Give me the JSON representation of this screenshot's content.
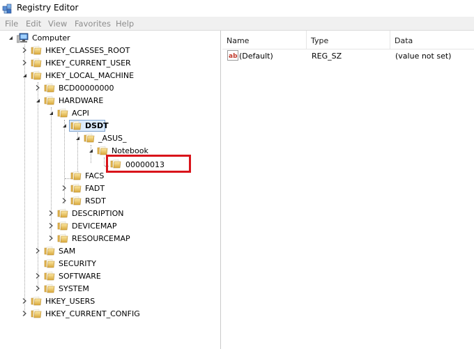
{
  "window": {
    "title": "Registry Editor"
  },
  "menu": [
    "File",
    "Edit",
    "View",
    "Favorites",
    "Help"
  ],
  "tree": {
    "root": "Computer",
    "hkcr": "HKEY_CLASSES_ROOT",
    "hkcu": "HKEY_CURRENT_USER",
    "hklm": "HKEY_LOCAL_MACHINE",
    "bcd": "BCD00000000",
    "hardware": "HARDWARE",
    "acpi": "ACPI",
    "dsdt": "DSDT",
    "asus": "_ASUS_",
    "notebook": "Notebook",
    "key13": "00000013",
    "facs": "FACS",
    "fadt": "FADT",
    "rsdt": "RSDT",
    "description": "DESCRIPTION",
    "devicemap": "DEVICEMAP",
    "resourcemap": "RESOURCEMAP",
    "sam": "SAM",
    "security": "SECURITY",
    "software": "SOFTWARE",
    "system": "SYSTEM",
    "hku": "HKEY_USERS",
    "hkcc": "HKEY_CURRENT_CONFIG"
  },
  "list": {
    "columns": {
      "name": "Name",
      "type": "Type",
      "data": "Data"
    },
    "rows": [
      {
        "name": "(Default)",
        "type": "REG_SZ",
        "data": "(value not set)"
      }
    ]
  },
  "colors": {
    "folder": "#e8c35a",
    "highlight": "#d9141b"
  }
}
